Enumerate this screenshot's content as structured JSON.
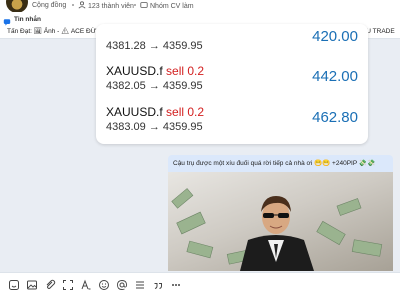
{
  "topbar": {
    "community_label": "Cộng đồng",
    "members_label": "123 thành viên",
    "group_label": "Nhóm CV làm"
  },
  "pinned": {
    "title": "Tin nhắn",
    "text": "Tấn Đạt: 🖼 Ảnh - ⚠ ACE ĐỪNG QUÊN KHUNG GIỜ VÀO LỆNH CỦA VIP DAYTRADE NHÉ! 👌 🔔 KHUNG GIỜ TÍN HIỆU TRADE GOLD VIP ..."
  },
  "trades": {
    "partial_value": "420.00",
    "partial_price": "4381.28 → 4359.95",
    "rows": [
      {
        "symbol": "XAUUSD.f",
        "action": "sell 0.2",
        "price": "4382.05 → 4359.95",
        "profit": "442.00"
      },
      {
        "symbol": "XAUUSD.f",
        "action": "sell 0.2",
        "price": "4383.09 → 4359.95",
        "profit": "462.80"
      }
    ]
  },
  "message": {
    "text": "Cậu trụ được một xíu đuối quá rời tiếp cả nhà ơi 😁😁 +240PIP 💸💸"
  },
  "colors": {
    "profit": "#1a6fb5",
    "sell": "#d32020",
    "bubble": "#dbe8fb"
  },
  "icons": {
    "bottom": [
      "sticker-icon",
      "image-icon",
      "attachment-icon",
      "screenshot-icon",
      "text-format-icon",
      "emoji-icon",
      "mention-icon",
      "menu-icon",
      "quote-icon",
      "more-icon"
    ]
  }
}
